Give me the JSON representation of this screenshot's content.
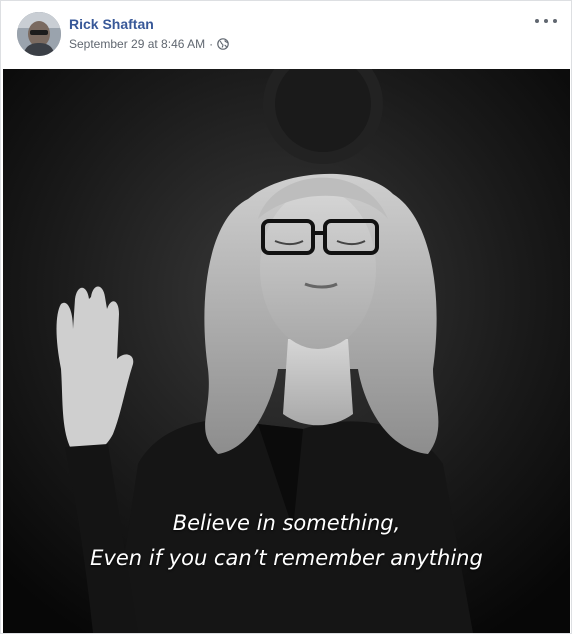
{
  "post": {
    "author": "Rick Shaftan",
    "timestamp": "September 29 at 8:46 AM",
    "separator": "·",
    "privacy_icon": "globe-icon",
    "more_icon": "more-options-icon"
  },
  "photo": {
    "caption_line1": "Believe in something,",
    "caption_line2": "Even if you can’t remember anything"
  },
  "colors": {
    "author_link": "#385898",
    "meta_text": "#606770",
    "border": "#dddfe2"
  }
}
